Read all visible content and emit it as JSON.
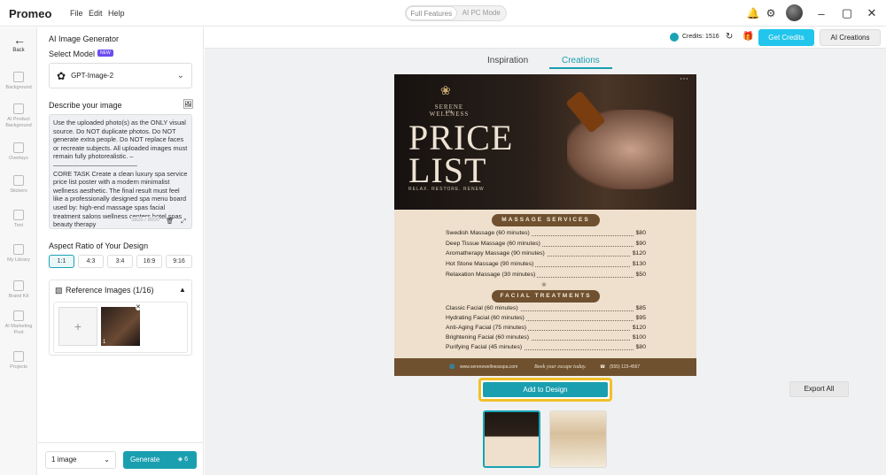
{
  "app": {
    "name": "Promeo",
    "menus": [
      "File",
      "Edit",
      "Help"
    ],
    "mode_options": [
      "Full Features",
      "AI PC Mode"
    ]
  },
  "rail": {
    "back": "Back",
    "items": [
      "Background",
      "AI Product Background",
      "Overlays",
      "Stickers",
      "Text",
      "My Library",
      "Brand Kit",
      "AI Marketing Post",
      "Projects"
    ]
  },
  "panel": {
    "title": "AI Image Generator",
    "select_model_label": "Select Model",
    "new_badge": "NEW",
    "model": "GPT-Image-2",
    "describe_label": "Describe your image",
    "prompt": "Use the uploaded photo(s) as the ONLY visual source. Do NOT duplicate photos. Do NOT generate extra people. Do NOT replace faces or recreate subjects. All uploaded images must remain fully photorealistic. –—————————————\nCORE TASK Create a clean luxury spa service price list poster with a modern minimalist wellness aesthetic. The final result must feel like a professionally designed spa menu board used by: high-end massage spas facial treatment salons wellness centers hotel spas beauty therapy",
    "char_count": "3825 / 8000",
    "aspect_label": "Aspect Ratio of Your Design",
    "ratios": [
      "1:1",
      "4:3",
      "3:4",
      "16:9",
      "9:16"
    ],
    "selected_ratio": "1:1",
    "reference_label": "Reference Images (1/16)",
    "ref_count": "1",
    "image_count": "1 image",
    "generate": "Generate",
    "generate_cost": "6"
  },
  "main": {
    "credits": "Credits: 1516",
    "get_credits": "Get Credits",
    "ai_creations": "AI Creations",
    "tabs": [
      "Inspiration",
      "Creations"
    ],
    "active_tab": "Creations",
    "add_to_design": "Add to Design",
    "export_all": "Export All"
  },
  "poster": {
    "brand": "SERENE WELLNESS",
    "brand_sub": "SPA",
    "title_line1": "PRICE",
    "title_line2": "LIST",
    "tagline": "RELAX. RESTORE. RENEW",
    "massage_header": "MASSAGE SERVICES",
    "massage": [
      {
        "name": "Swedish Massage (60 minutes)",
        "price": "$80"
      },
      {
        "name": "Deep Tissue Massage (60 minutes)",
        "price": "$90"
      },
      {
        "name": "Aromatherapy Massage (90 minutes)",
        "price": "$120"
      },
      {
        "name": "Hot Stone Massage (90 minutes)",
        "price": "$130"
      },
      {
        "name": "Relaxation Massage (30 minutes)",
        "price": "$50"
      }
    ],
    "facial_header": "FACIAL TREATMENTS",
    "facial": [
      {
        "name": "Classic Facial (60 minutes)",
        "price": "$85"
      },
      {
        "name": "Hydrating Facial (60 minutes)",
        "price": "$95"
      },
      {
        "name": "Anti-Aging Facial (75 minutes)",
        "price": "$120"
      },
      {
        "name": "Brightening Facial (60 minutes)",
        "price": "$100"
      },
      {
        "name": "Purifying Facial (45 minutes)",
        "price": "$80"
      }
    ],
    "footer_web": "www.serenewellnessspa.com",
    "footer_cta": "Book your escape today.",
    "footer_phone": "(555) 123-4567"
  },
  "colors": {
    "accent": "#1a9fb0",
    "highlight": "#f2c028",
    "poster_brown": "#6f5130"
  }
}
